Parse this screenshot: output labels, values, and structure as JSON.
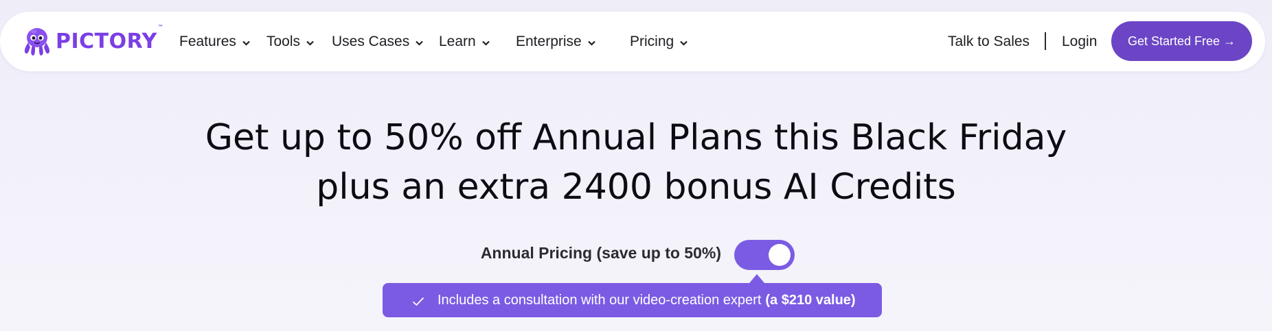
{
  "brand": {
    "name": "PICTORY",
    "trademark": "™",
    "logo_icon": "octopus-mascot-icon",
    "accent_color": "#7b3fe4"
  },
  "nav": {
    "items": [
      {
        "label": "Features",
        "icon": "chevron-down-icon"
      },
      {
        "label": "Tools",
        "icon": "chevron-down-icon"
      },
      {
        "label": "Uses Cases",
        "icon": "chevron-down-icon"
      },
      {
        "label": "Learn",
        "icon": "chevron-down-icon"
      },
      {
        "label": "Enterprise",
        "icon": "chevron-down-icon"
      },
      {
        "label": "Pricing",
        "icon": "chevron-down-icon"
      }
    ],
    "talk_to_sales": "Talk to Sales",
    "login": "Login",
    "cta": "Get Started Free →",
    "cta_color": "#6b45c6"
  },
  "hero": {
    "line1": "Get up to 50% off Annual Plans this Black Friday",
    "line2": "plus an extra 2400 bonus AI Credits"
  },
  "pricing_toggle": {
    "label": "Annual Pricing (save up to 50%)",
    "state": "on",
    "color": "#7b5be4"
  },
  "callout": {
    "icon": "check-icon",
    "text": "Includes a consultation with our video-creation expert",
    "highlight": "(a $210 value)"
  }
}
